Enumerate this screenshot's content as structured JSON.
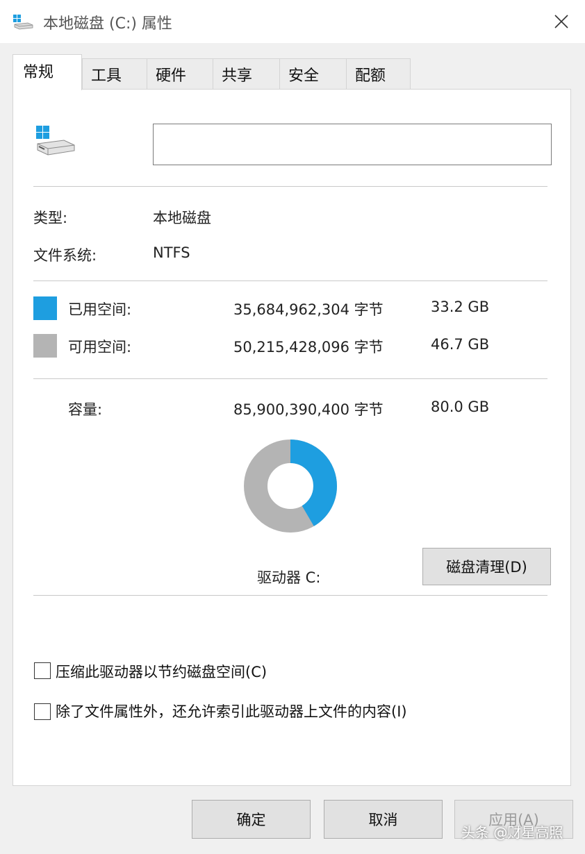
{
  "window": {
    "title": "本地磁盘 (C:) 属性"
  },
  "tabs": [
    {
      "label": "常规",
      "active": true
    },
    {
      "label": "工具",
      "active": false
    },
    {
      "label": "硬件",
      "active": false
    },
    {
      "label": "共享",
      "active": false
    },
    {
      "label": "安全",
      "active": false
    },
    {
      "label": "配额",
      "active": false
    }
  ],
  "general": {
    "name_value": "",
    "type_label": "类型:",
    "type_value": "本地磁盘",
    "fs_label": "文件系统:",
    "fs_value": "NTFS",
    "used": {
      "label": "已用空间:",
      "bytes": "35,684,962,304 字节",
      "size": "33.2 GB",
      "color": "#1e9ee0"
    },
    "free": {
      "label": "可用空间:",
      "bytes": "50,215,428,096 字节",
      "size": "46.7 GB",
      "color": "#b4b4b4"
    },
    "capacity": {
      "label": "容量:",
      "bytes": "85,900,390,400 字节",
      "size": "80.0 GB"
    },
    "used_fraction": 0.415,
    "drive_label": "驱动器 C:",
    "cleanup_button": "磁盘清理(D)"
  },
  "options": {
    "compress_label": "压缩此驱动器以节约磁盘空间(C)",
    "compress_checked": false,
    "index_label": "除了文件属性外，还允许索引此驱动器上文件的内容(I)",
    "index_checked": false
  },
  "buttons": {
    "ok": "确定",
    "cancel": "取消",
    "apply": "应用(A)"
  },
  "watermark": "头条 @财星高照"
}
